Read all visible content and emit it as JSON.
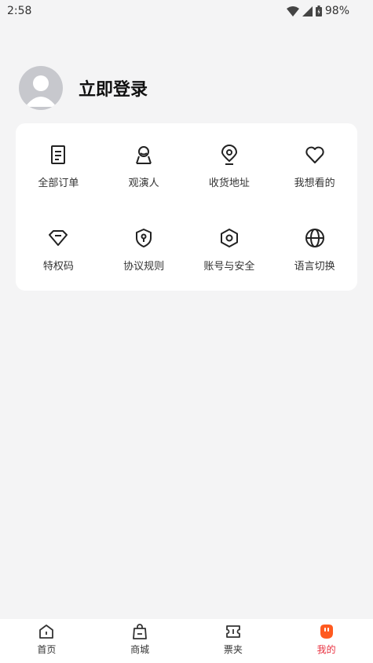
{
  "status": {
    "time": "2:58",
    "battery": "98%"
  },
  "profile": {
    "login_text": "立即登录"
  },
  "menu": [
    {
      "label": "全部订单",
      "icon": "document-icon"
    },
    {
      "label": "观演人",
      "icon": "person-badge-icon"
    },
    {
      "label": "收货地址",
      "icon": "location-pin-icon"
    },
    {
      "label": "我想看的",
      "icon": "heart-icon"
    },
    {
      "label": "特权码",
      "icon": "diamond-icon"
    },
    {
      "label": "协议规则",
      "icon": "shield-icon"
    },
    {
      "label": "账号与安全",
      "icon": "hexagon-icon"
    },
    {
      "label": "语言切换",
      "icon": "globe-icon"
    }
  ],
  "tabs": [
    {
      "label": "首页",
      "icon": "home-icon"
    },
    {
      "label": "商城",
      "icon": "shopping-bag-icon"
    },
    {
      "label": "票夹",
      "icon": "ticket-icon"
    },
    {
      "label": "我的",
      "icon": "profile-face-icon",
      "active": true
    }
  ],
  "colors": {
    "accent": "#e8303f",
    "accent_icon": "#ff5a1f",
    "background": "#f4f4f5",
    "card": "#ffffff"
  }
}
